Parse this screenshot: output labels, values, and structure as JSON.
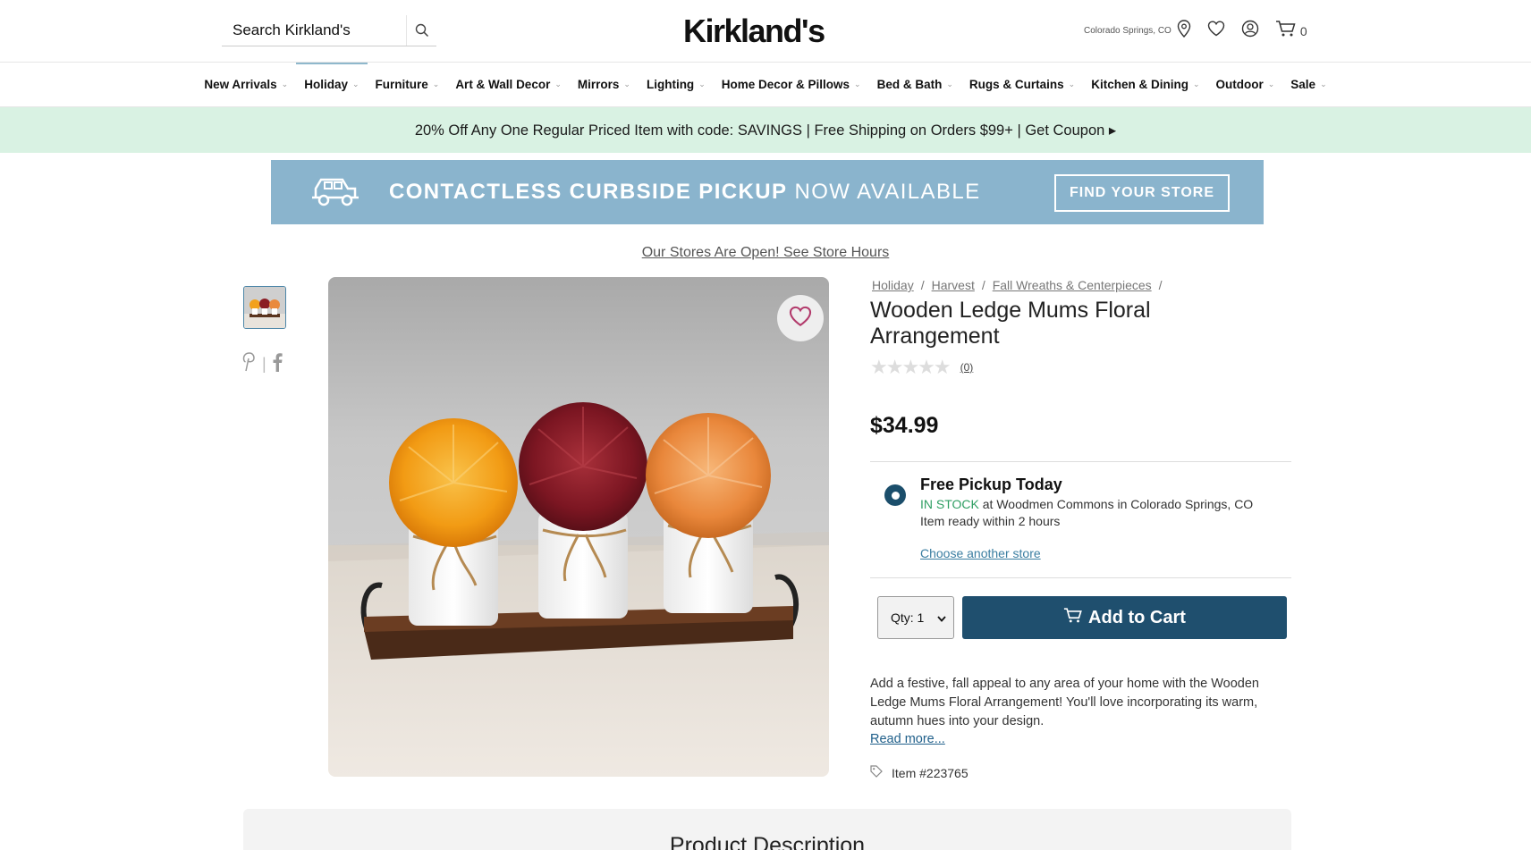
{
  "header": {
    "search_placeholder": "Search Kirkland's",
    "logo": "Kirkland's",
    "location": "Colorado Springs, CO",
    "cart_count": "0"
  },
  "nav": {
    "items": [
      {
        "label": "New Arrivals"
      },
      {
        "label": "Holiday"
      },
      {
        "label": "Furniture"
      },
      {
        "label": "Art & Wall Decor"
      },
      {
        "label": "Mirrors"
      },
      {
        "label": "Lighting"
      },
      {
        "label": "Home Decor & Pillows"
      },
      {
        "label": "Bed & Bath"
      },
      {
        "label": "Rugs & Curtains"
      },
      {
        "label": "Kitchen & Dining"
      },
      {
        "label": "Outdoor"
      },
      {
        "label": "Sale"
      }
    ]
  },
  "promo": {
    "text": "20% Off Any One Regular Priced Item with code: SAVINGS | Free Shipping on Orders $99+ | Get Coupon ▸"
  },
  "banner": {
    "title_bold": "CONTACTLESS CURBSIDE PICKUP",
    "title_light": "NOW AVAILABLE",
    "button": "FIND YOUR STORE"
  },
  "store_hours_link": "Our Stores Are Open! See Store Hours",
  "breadcrumb": [
    "Holiday",
    "Harvest",
    "Fall Wreaths & Centerpieces"
  ],
  "product": {
    "title": "Wooden Ledge Mums Floral Arrangement",
    "rating_count": "(0)",
    "price": "$34.99",
    "pickup_title": "Free Pickup Today",
    "in_stock": "IN STOCK",
    "store_text": "at Woodmen Commons in Colorado Springs, CO",
    "ready_text": "Item ready within 2 hours",
    "choose_store": "Choose another store",
    "qty_label": "Qty: 1",
    "add_to_cart": "Add to Cart",
    "description": "Add a festive, fall appeal to any area of your home with the Wooden Ledge Mums Floral Arrangement! You'll love incorporating its warm, autumn hues into your design.",
    "read_more": "Read more...",
    "item_number": "Item #223765"
  },
  "product_description_heading": "Product Description",
  "colors": {
    "primary_button": "#1f4f6e",
    "promo_bg": "#d9f2e3",
    "banner_bg": "#8ab4cd",
    "in_stock": "#2e9e62"
  }
}
